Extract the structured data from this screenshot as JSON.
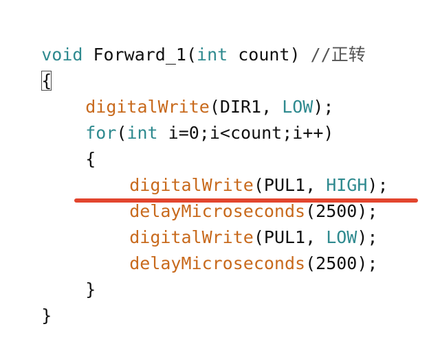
{
  "code": {
    "line1": {
      "kw_void": "void",
      "name": " Forward_1(",
      "kw_int": "int",
      "rest": " count) ",
      "comment": "//正转"
    },
    "line2": {
      "brace": "{"
    },
    "line3": {
      "fn": "digitalWrite",
      "args_a": "(DIR1, ",
      "const": "LOW",
      "args_b": ");"
    },
    "line4": {
      "kw_for": "for",
      "paren": "(",
      "kw_int": "int",
      "rest": " i=0;i<count;i++)"
    },
    "line5": {
      "brace": "{"
    },
    "line6": {
      "fn": "digitalWrite",
      "args_a": "(PUL1, ",
      "const": "HIGH",
      "args_b": ");"
    },
    "line7": {
      "fn": "delayMicroseconds",
      "args": "(2500);"
    },
    "line8": {
      "fn": "digitalWrite",
      "args_a": "(PUL1, ",
      "const": "LOW",
      "args_b": ");"
    },
    "line9": {
      "fn": "delayMicroseconds",
      "args": "(2500);"
    },
    "line10": {
      "brace": "}"
    },
    "line11": {
      "brace": "}"
    }
  },
  "colors": {
    "keyword": "#2f8a8f",
    "function": "#c86a1d",
    "text": "#111111",
    "underline": "#e2452e"
  }
}
